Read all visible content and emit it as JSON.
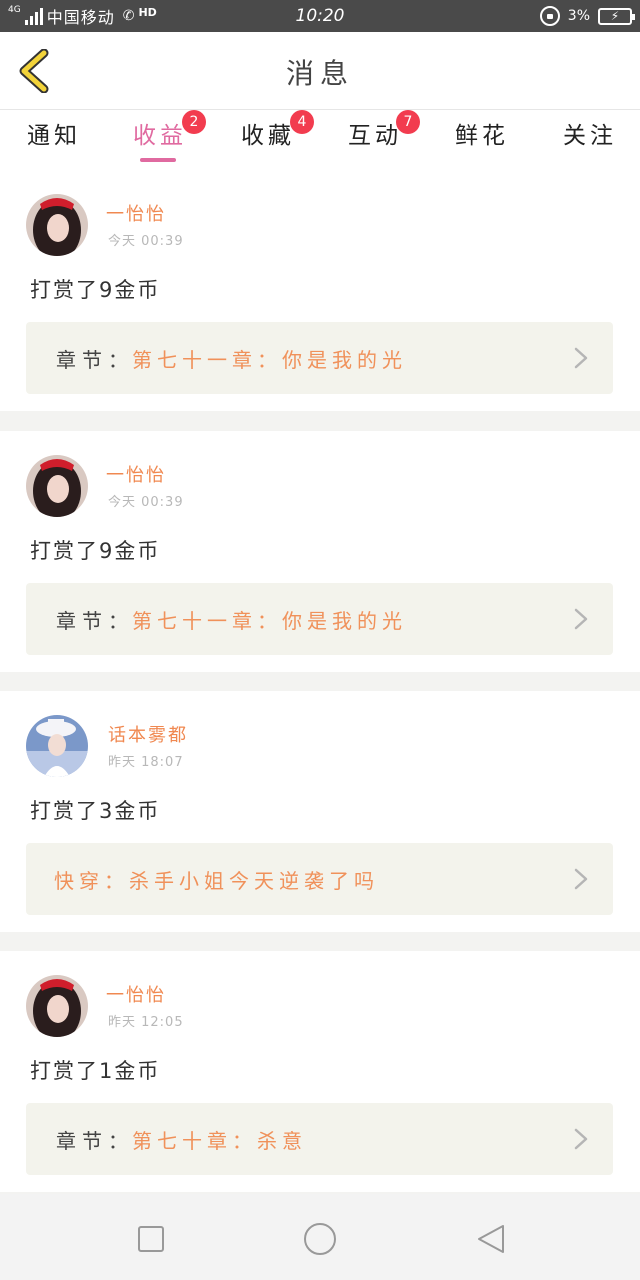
{
  "status_bar": {
    "network": "4G",
    "carrier": "中国移动",
    "hd": "HD",
    "time": "10:20",
    "battery_percent": "3%",
    "icons": [
      "signal-icon",
      "call-icon",
      "rotation-lock-icon",
      "battery-charging-icon"
    ]
  },
  "header": {
    "title": "消息",
    "back_icon": "chevron-left-icon"
  },
  "tabs": [
    {
      "label": "通知",
      "badge": null,
      "active": false
    },
    {
      "label": "收益",
      "badge": "2",
      "active": true
    },
    {
      "label": "收藏",
      "badge": "4",
      "active": false
    },
    {
      "label": "互动",
      "badge": "7",
      "active": false
    },
    {
      "label": "鲜花",
      "badge": null,
      "active": false
    },
    {
      "label": "关注",
      "badge": null,
      "active": false
    }
  ],
  "messages": [
    {
      "sender": "一怡怡",
      "time": "今天 00:39",
      "text": "打赏了9金币",
      "chapter_prefix": "章节：",
      "chapter_title": "第七十一章：你是我的光"
    },
    {
      "sender": "一怡怡",
      "time": "今天 00:39",
      "text": "打赏了9金币",
      "chapter_prefix": "章节：",
      "chapter_title": "第七十一章：你是我的光"
    },
    {
      "sender": "话本雾都",
      "time": "昨天 18:07",
      "text": "打赏了3金币",
      "chapter_prefix": "",
      "chapter_title": "快穿：杀手小姐今天逆袭了吗"
    },
    {
      "sender": "一怡怡",
      "time": "昨天 12:05",
      "text": "打赏了1金币",
      "chapter_prefix": "章节：",
      "chapter_title": "第七十章：杀意"
    }
  ],
  "colors": {
    "accent_pink": "#e06aa0",
    "name_orange": "#f08850",
    "badge_red": "#f23c4f",
    "back_yellow": "#f2d33a"
  },
  "nav": {
    "icons": [
      "recent-apps-icon",
      "home-icon",
      "back-icon"
    ]
  }
}
